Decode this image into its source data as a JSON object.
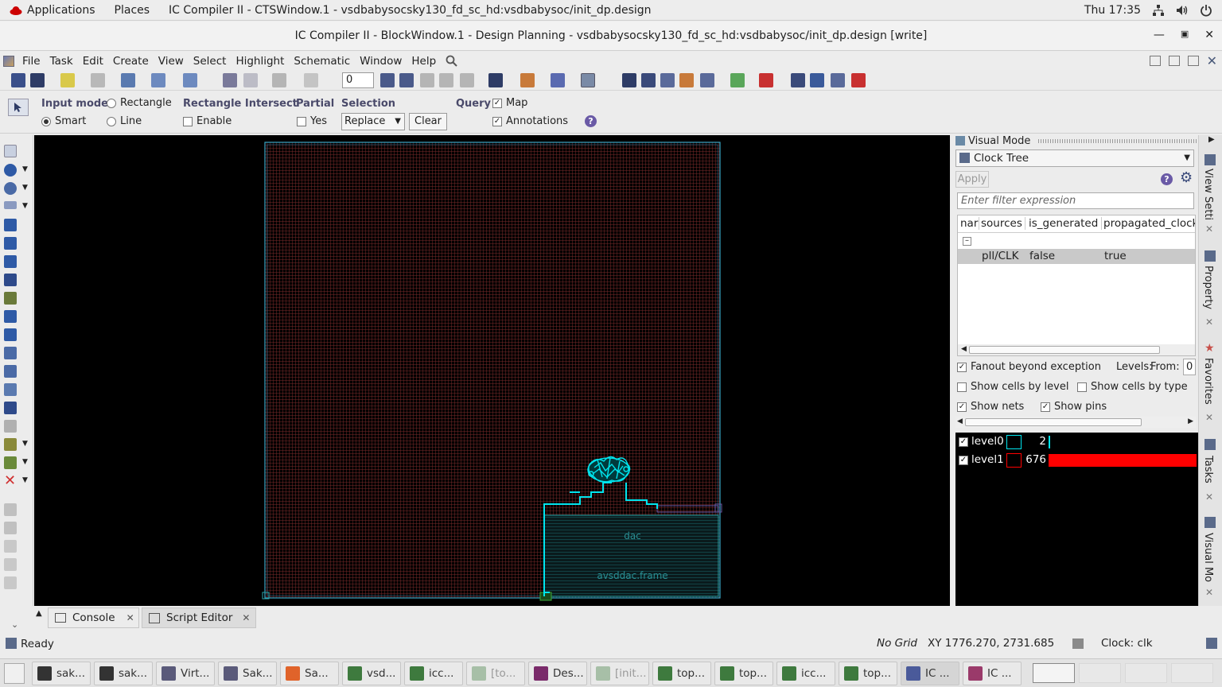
{
  "topbar": {
    "applications": "Applications",
    "places": "Places",
    "active_window": "IC Compiler II - CTSWindow.1 - vsdbabysocsky130_fd_sc_hd:vsdbabysoc/init_dp.design",
    "clock": "Thu 17:35"
  },
  "window": {
    "title": "IC Compiler II - BlockWindow.1 - Design Planning - vsdbabysocsky130_fd_sc_hd:vsdbabysoc/init_dp.design [write]"
  },
  "menu": [
    "File",
    "Task",
    "Edit",
    "Create",
    "View",
    "Select",
    "Highlight",
    "Schematic",
    "Window",
    "Help"
  ],
  "toolbar": {
    "layer_value": "0"
  },
  "options": {
    "input_mode_label": "Input mode",
    "input_rect": "Rectangle",
    "input_smart": "Smart",
    "input_line": "Line",
    "rect_intersect_label": "Rectangle Intersect",
    "rect_enable": "Enable",
    "partial_label": "Partial",
    "partial_yes": "Yes",
    "selection_label": "Selection",
    "selection_value": "Replace",
    "clear_button": "Clear",
    "query_label": "Query",
    "query_map": "Map",
    "query_annotations": "Annotations"
  },
  "canvas": {
    "macro_label": "dac",
    "macro_frame_label": "avsddac.frame"
  },
  "visual_mode": {
    "header": "Visual Mode",
    "mode": "Clock Tree",
    "apply_button": "Apply",
    "filter_placeholder": "Enter filter expression",
    "columns": [
      "nar",
      "sources",
      "is_generated",
      "propagated_clock"
    ],
    "rows": [
      {
        "sources": "pll/CLK",
        "is_generated": "false",
        "propagated_clock": "true"
      }
    ],
    "fanout_beyond_exception": "Fanout beyond exception",
    "levels_label": "Levels:",
    "from_label": "From:",
    "from_value": "0",
    "show_cells_by_level": "Show cells by level",
    "show_cells_by_type": "Show cells by type",
    "show_nets": "Show nets",
    "show_pins": "Show pins",
    "levels": [
      {
        "name": "level0",
        "count": "2",
        "color": "#00e5ee",
        "fraction": 0.003
      },
      {
        "name": "level1",
        "count": "676",
        "color": "#ff0000",
        "fraction": 1.0
      }
    ]
  },
  "side_tabs": [
    "View Setti",
    "Property",
    "Favorites",
    "Tasks",
    "Visual Mo"
  ],
  "console": {
    "tab_console": "Console",
    "tab_script": "Script Editor"
  },
  "status": {
    "ready": "Ready",
    "grid": "No Grid",
    "xy": "XY 1776.270, 2731.685",
    "clock": "Clock: clk"
  },
  "taskbar": [
    {
      "label": "sak...",
      "color": "#333333",
      "dim": false,
      "active": false
    },
    {
      "label": "sak...",
      "color": "#333333",
      "dim": false,
      "active": false
    },
    {
      "label": "Virt...",
      "color": "#5a5a7a",
      "dim": false,
      "active": false
    },
    {
      "label": "Sak...",
      "color": "#5a5a7a",
      "dim": false,
      "active": false
    },
    {
      "label": "Sa...",
      "color": "#e0632a",
      "dim": false,
      "active": false
    },
    {
      "label": "vsd...",
      "color": "#3e7a3e",
      "dim": false,
      "active": false
    },
    {
      "label": "icc...",
      "color": "#3e7a3e",
      "dim": false,
      "active": false
    },
    {
      "label": "[to...",
      "color": "#a7bfa7",
      "dim": true,
      "active": false
    },
    {
      "label": "Des...",
      "color": "#7a2a6a",
      "dim": false,
      "active": false
    },
    {
      "label": "[init...",
      "color": "#a7bfa7",
      "dim": true,
      "active": false
    },
    {
      "label": "top...",
      "color": "#3e7a3e",
      "dim": false,
      "active": false
    },
    {
      "label": "top...",
      "color": "#3e7a3e",
      "dim": false,
      "active": false
    },
    {
      "label": "icc...",
      "color": "#3e7a3e",
      "dim": false,
      "active": false
    },
    {
      "label": "top...",
      "color": "#3e7a3e",
      "dim": false,
      "active": false
    },
    {
      "label": "IC ...",
      "color": "#4a5a9a",
      "dim": false,
      "active": true
    },
    {
      "label": "IC ...",
      "color": "#9a3a6a",
      "dim": false,
      "active": false
    }
  ]
}
